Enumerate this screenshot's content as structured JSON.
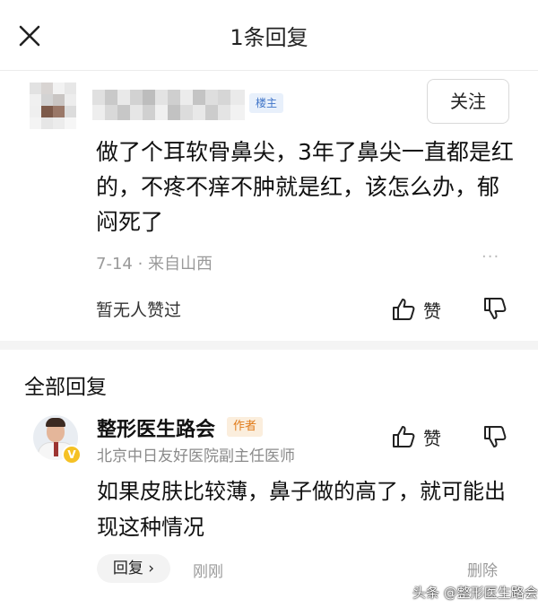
{
  "header": {
    "title": "1条回复",
    "close_icon": "close-icon"
  },
  "post": {
    "author_badge": "楼主",
    "follow_label": "关注",
    "text": "做了个耳软骨鼻尖，3年了鼻尖一直都是红的，不疼不痒不肿就是红，该怎么办，郁闷死了",
    "meta": "7-14 · 来自山西",
    "more_icon": "···",
    "no_likes": "暂无人赞过",
    "like_label": "赞"
  },
  "section_title": "全部回复",
  "reply": {
    "author": "整形医生路会",
    "author_badge": "作者",
    "author_title": "北京中日友好医院副主任医师",
    "verified": "V",
    "like_label": "赞",
    "text": "如果皮肤比较薄，鼻子做的高了，就可能出现这种情况",
    "reply_label": "回复 ›",
    "time": "刚刚",
    "delete_label": "删除"
  },
  "watermark": "头条 @整形医生路会",
  "colors": {
    "badge_blue": "#3f74c8",
    "badge_orange": "#e07a18",
    "verified_yellow": "#f5c125"
  }
}
